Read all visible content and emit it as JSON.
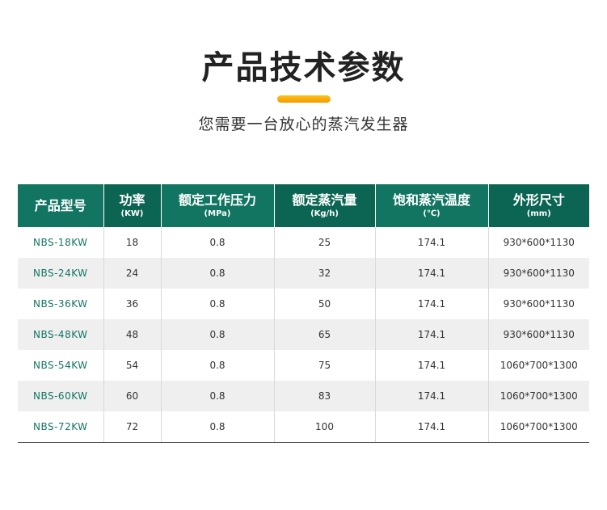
{
  "title": "产品技术参数",
  "subtitle": "您需要一台放心的蒸汽发生器",
  "colors": {
    "header_bg": "#117561",
    "header_bg_alt": "#0c6553",
    "accent_bar": "#f5a200",
    "model_text": "#117561",
    "row_alt_bg": "#efefef"
  },
  "table": {
    "headers": [
      {
        "name": "产品型号",
        "unit": ""
      },
      {
        "name": "功率",
        "unit": "(KW)"
      },
      {
        "name": "额定工作压力",
        "unit": "(MPa)"
      },
      {
        "name": "额定蒸汽量",
        "unit": "(Kg/h)"
      },
      {
        "name": "饱和蒸汽温度",
        "unit": "(℃)"
      },
      {
        "name": "外形尺寸",
        "unit": "(mm)"
      }
    ],
    "rows": [
      [
        "NBS-18KW",
        "18",
        "0.8",
        "25",
        "174.1",
        "930*600*1130"
      ],
      [
        "NBS-24KW",
        "24",
        "0.8",
        "32",
        "174.1",
        "930*600*1130"
      ],
      [
        "NBS-36KW",
        "36",
        "0.8",
        "50",
        "174.1",
        "930*600*1130"
      ],
      [
        "NBS-48KW",
        "48",
        "0.8",
        "65",
        "174.1",
        "930*600*1130"
      ],
      [
        "NBS-54KW",
        "54",
        "0.8",
        "75",
        "174.1",
        "1060*700*1300"
      ],
      [
        "NBS-60KW",
        "60",
        "0.8",
        "83",
        "174.1",
        "1060*700*1300"
      ],
      [
        "NBS-72KW",
        "72",
        "0.8",
        "100",
        "174.1",
        "1060*700*1300"
      ]
    ]
  }
}
